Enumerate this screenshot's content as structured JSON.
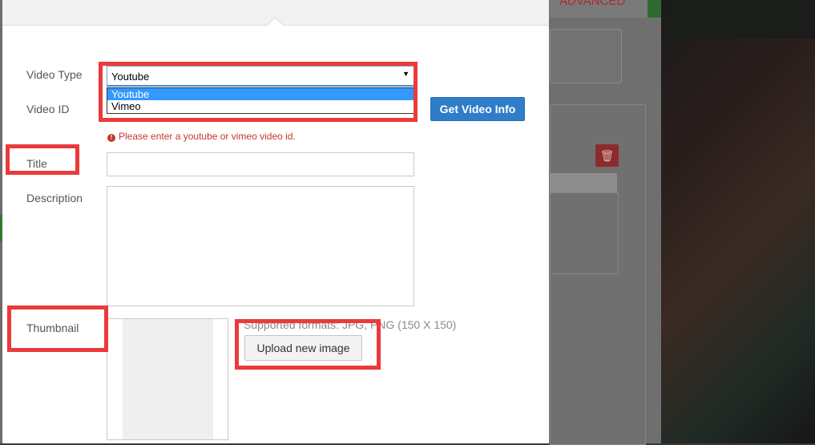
{
  "background": {
    "tab_label": "ADVANCED",
    "trash_icon": "trash-icon"
  },
  "form": {
    "video_type_label": "Video Type",
    "video_type_value": "Youtube",
    "video_type_options": [
      "Youtube",
      "Vimeo"
    ],
    "video_type_selected_option": "Youtube",
    "video_id_label": "Video ID",
    "get_info_button": "Get Video Info",
    "error_message": "Please enter a youtube or vimeo video id.",
    "title_label": "Title",
    "title_value": "",
    "description_label": "Description",
    "description_value": "",
    "thumbnail_label": "Thumbnail",
    "supported_formats": "Supported formats: JPG, PNG (150 X 150)",
    "upload_button": "Upload new image"
  },
  "colors": {
    "primary_button": "#2f7dc9",
    "error": "#c0392b",
    "annotation": "#ea3a3a",
    "selected_option": "#3399ff"
  }
}
